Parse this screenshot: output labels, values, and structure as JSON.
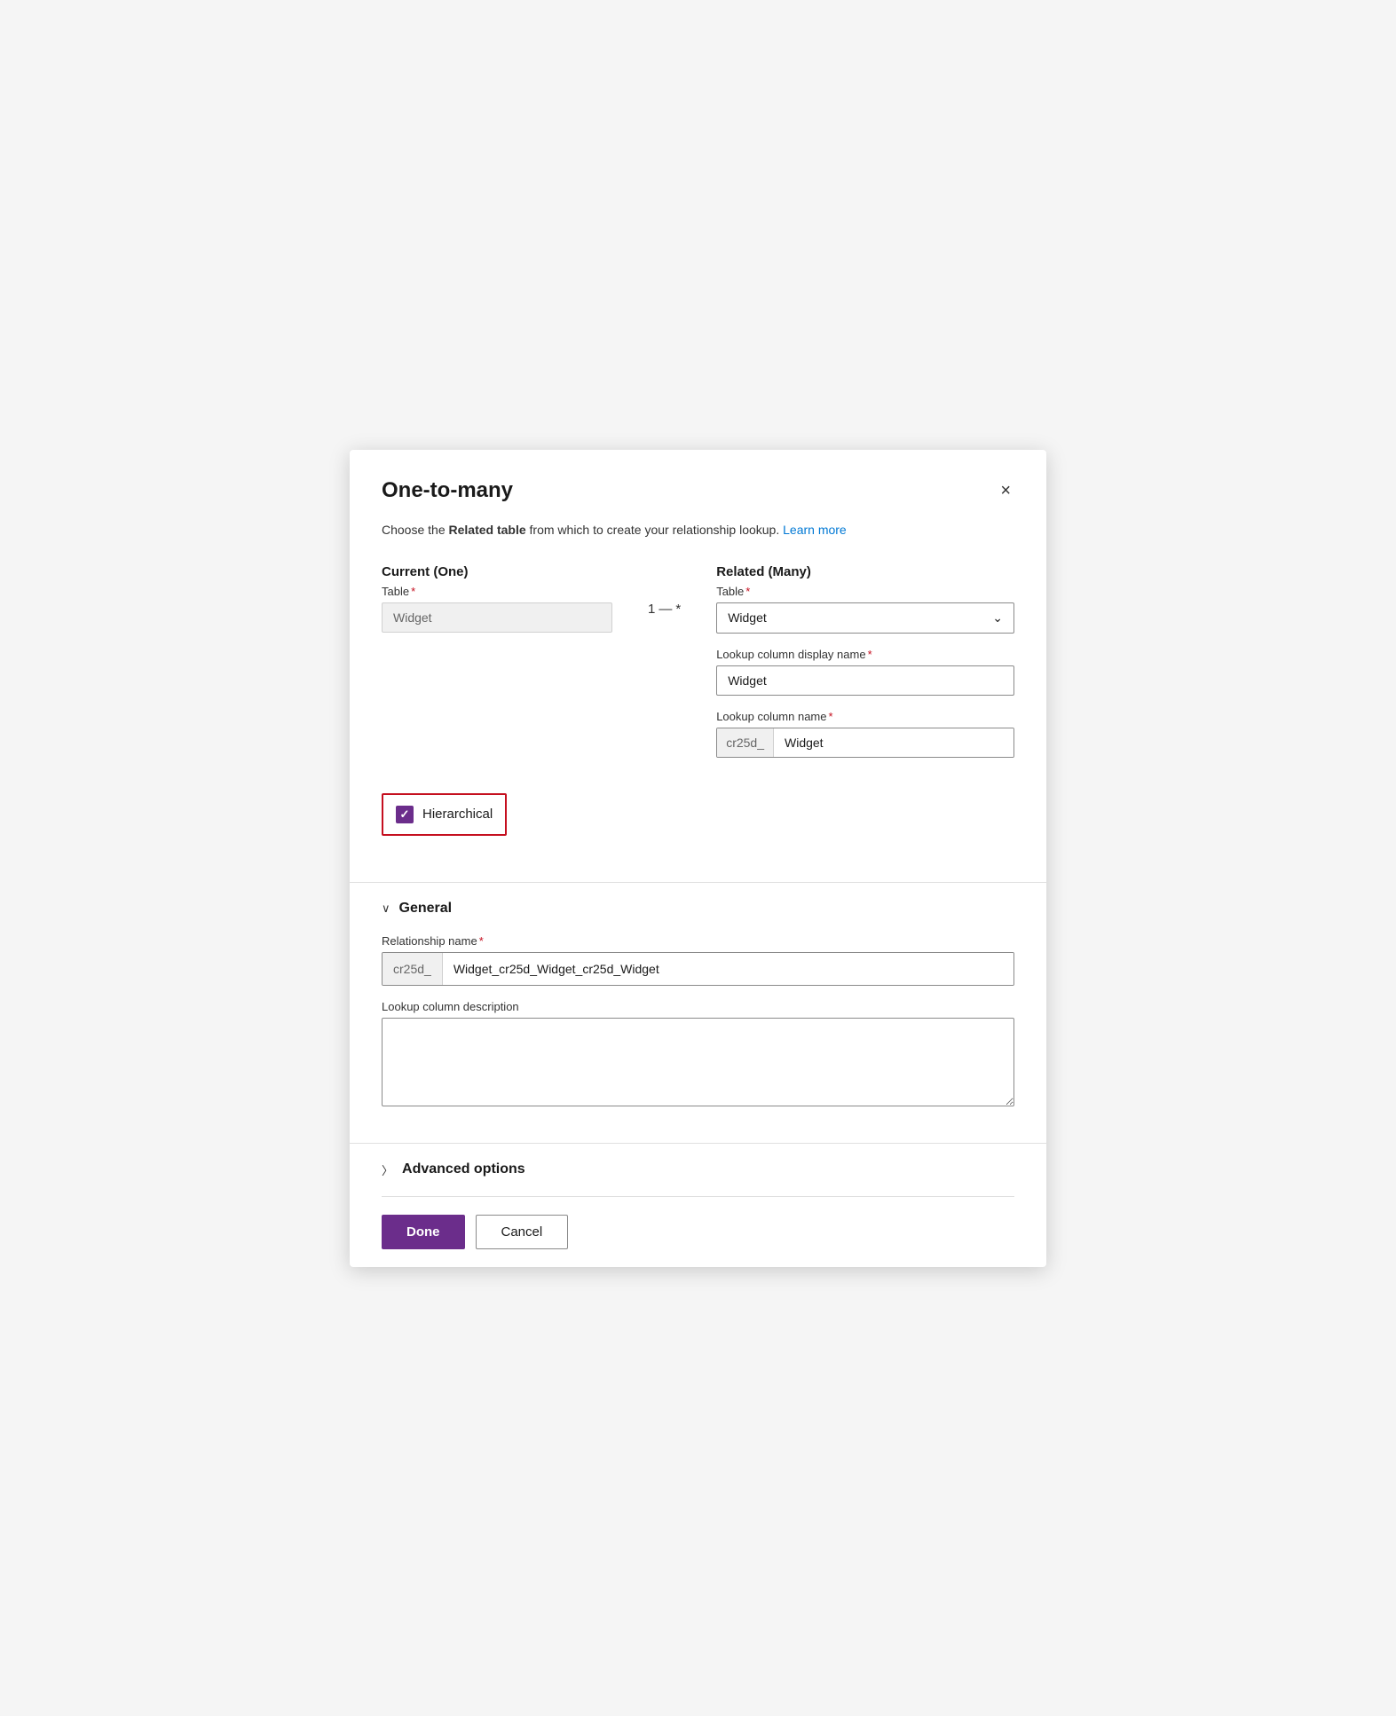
{
  "dialog": {
    "title": "One-to-many",
    "close_label": "×"
  },
  "subtitle": {
    "text_before": "Choose the ",
    "bold_text": "Related table",
    "text_after": " from which to create your relationship lookup. ",
    "link_text": "Learn more"
  },
  "current_section": {
    "label": "Current (One)",
    "table_label": "Table",
    "required": "*",
    "table_value": "Widget"
  },
  "arrow": {
    "left": "1",
    "dash": "—",
    "right": "*"
  },
  "related_section": {
    "label": "Related (Many)",
    "table_label": "Table",
    "required": "*",
    "table_value": "Widget",
    "lookup_display_label": "Lookup column display name",
    "lookup_display_required": "*",
    "lookup_display_value": "Widget",
    "lookup_name_label": "Lookup column name",
    "lookup_name_required": "*",
    "lookup_name_prefix": "cr25d_",
    "lookup_name_value": "Widget"
  },
  "hierarchical": {
    "label": "Hierarchical"
  },
  "general_section": {
    "label": "General",
    "collapsed": false,
    "relationship_name_label": "Relationship name",
    "relationship_name_required": "*",
    "relationship_name_prefix": "cr25d_",
    "relationship_name_value": "Widget_cr25d_Widget_cr25d_Widget",
    "description_label": "Lookup column description",
    "description_value": ""
  },
  "advanced_section": {
    "label": "Advanced options",
    "collapsed": true
  },
  "footer": {
    "done_label": "Done",
    "cancel_label": "Cancel"
  }
}
